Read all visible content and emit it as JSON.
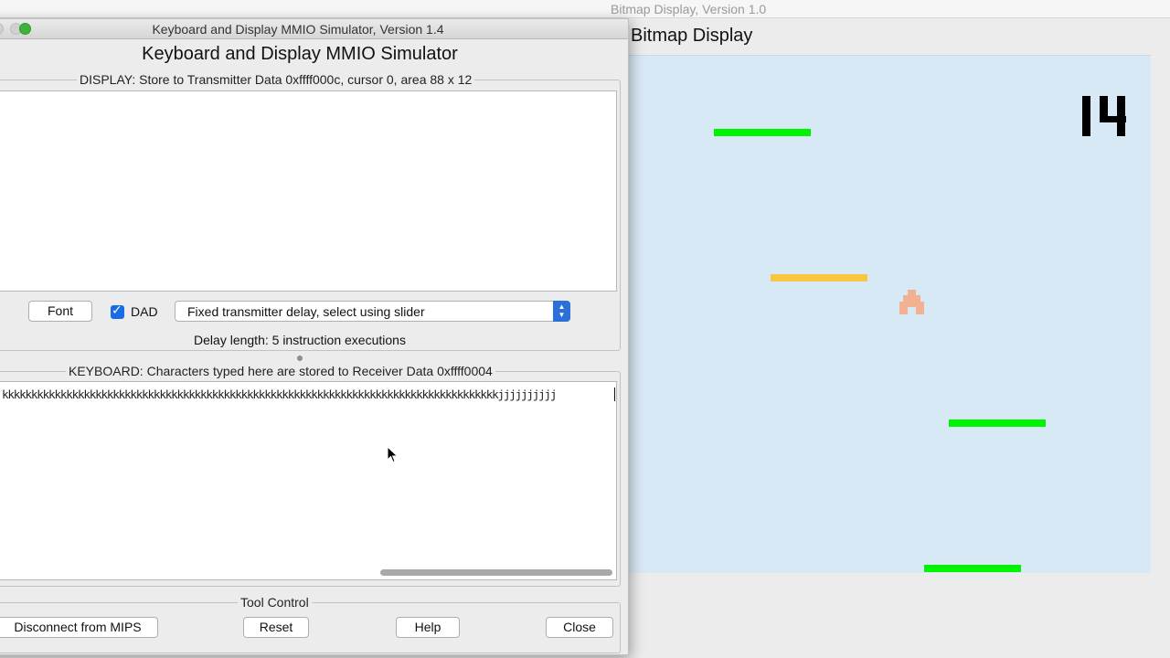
{
  "bitmap_window": {
    "window_title": "Bitmap Display, Version 1.0",
    "heading": "Bitmap Display",
    "score": "14",
    "colors": {
      "background": "#d8e9f6",
      "platform_green": "#00f300",
      "platform_yellow": "#f8c840",
      "player": "#f2b292",
      "score": "#000000"
    },
    "icons": [
      "score-digits-icon",
      "player-sprite-icon"
    ]
  },
  "mmio_window": {
    "window_title": "Keyboard and Display MMIO Simulator, Version 1.4",
    "heading": "Keyboard and Display MMIO Simulator",
    "display": {
      "group_title": "DISPLAY: Store to Transmitter Data 0xffff000c, cursor 0, area 88 x 12",
      "text": ""
    },
    "controls": {
      "font_button": "Font",
      "dad_label": "DAD",
      "dad_checked": true,
      "delay_select_value": "Fixed transmitter delay, select using slider",
      "delay_length_text": "Delay length: 5 instruction executions"
    },
    "keyboard": {
      "group_title": "KEYBOARD: Characters typed here are stored to Receiver Data 0xffff0004",
      "typed_text": "kkkkkkkkkkkkkkkkkkkkkkkkkkkkkkkkkkkkkkkkkkkkkkkkkkkkkkkkkkkkkkkkkkkkkkkkkkkkkkkkkkkkkjjjjjjjjjj"
    },
    "tool_control": {
      "group_title": "Tool Control",
      "disconnect_button": "Disconnect from MIPS",
      "reset_button": "Reset",
      "help_button": "Help",
      "close_button": "Close"
    },
    "colors": {
      "select_accent": "#2b6fd8",
      "checkbox": "#1a6ce6",
      "traffic_close": "#d0d0d0",
      "traffic_minimize": "#d0d0d0",
      "traffic_zoom": "#3fb23b"
    }
  }
}
